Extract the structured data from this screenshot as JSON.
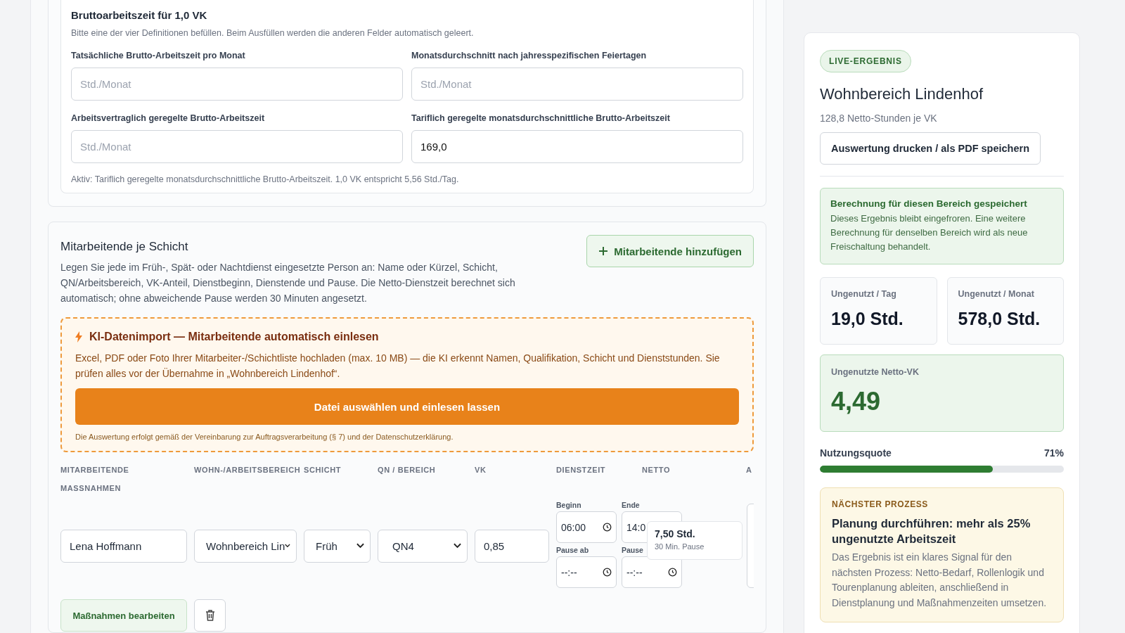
{
  "brutto": {
    "title": "Bruttoarbeitszeit für 1,0 VK",
    "hint": "Bitte eine der vier Definitionen befüllen. Beim Ausfüllen werden die anderen Felder automatisch geleert.",
    "fields": [
      {
        "label": "Tatsächliche Brutto-Arbeitszeit pro Monat",
        "placeholder": "Std./Monat"
      },
      {
        "label": "Monatsdurchschnitt nach jahresspezifischen Feiertagen",
        "placeholder": "Std./Monat"
      },
      {
        "label": "Arbeitsvertraglich geregelte Brutto-Arbeitszeit",
        "placeholder": "Std./Monat"
      },
      {
        "label": "Tariflich geregelte monatsdurchschnittliche Brutto-Arbeitszeit",
        "value": "169,0"
      }
    ],
    "active_note": "Aktiv: Tariflich geregelte monatsdurchschnittliche Brutto-Arbeitszeit. 1,0 VK entspricht 5,56 Std./Tag."
  },
  "staff": {
    "title": "Mitarbeitende je Schicht",
    "description": "Legen Sie jede im Früh-, Spät- oder Nachtdienst eingesetzte Person an: Name oder Kürzel, Schicht, QN/Arbeitsbereich, VK-Anteil, Dienstbeginn, Dienstende und Pause. Die Netto-Dienstzeit berechnet sich automatisch; ohne abweichende Pause werden 30 Minuten angesetzt.",
    "add_button": "Mitarbeitende hinzufügen",
    "import": {
      "title": "KI-Datenimport — Mitarbeitende automatisch einlesen",
      "text": "Excel, PDF oder Foto Ihrer Mitarbeiter-/Schichtliste hochladen (max. 10 MB) — die KI erkennt Namen, Qualifikation, Schicht und Dienststunden. Sie prüfen alles vor der Übernahme in „Wohnbereich Lindenhof“.",
      "button": "Datei auswählen und einlesen lassen",
      "note": "Die Auswertung erfolgt gemäß der Vereinbarung zur Auftragsverarbeitung (§ 7) und der Datenschutzerklärung."
    },
    "columns": [
      "MITARBEITENDE",
      "WOHN-/ARBEITSBEREICH",
      "SCHICHT",
      "QN / BEREICH",
      "VK",
      "DIENSTZEIT",
      "NETTO",
      "A",
      "MASSNAHMEN"
    ],
    "rows": [
      {
        "name": "Lena Hoffmann",
        "area": "Wohnbereich Lin",
        "shift": "Früh",
        "qualification": "QN4",
        "vk": "0,85",
        "start_label": "Beginn",
        "start": "06:00",
        "end_label": "Ende",
        "end": "14:0",
        "pause_from_label": "Pause ab",
        "pause_from": "--:--",
        "pause_to_label": "Pause",
        "pause_to": "--:--",
        "net_hours": "7,50 Std.",
        "net_pause": "30 Min. Pause",
        "actions_button": "Maßnahmen bearbeiten"
      }
    ]
  },
  "result": {
    "badge": "LIVE-ERGEBNIS",
    "title": "Wohnbereich Lindenhof",
    "subtitle": "128,8 Netto-Stunden je VK",
    "print_button": "Auswertung drucken / als PDF speichern",
    "saved": {
      "title": "Berechnung für diesen Bereich gespeichert",
      "text": "Dieses Ergebnis bleibt eingefroren. Eine weitere Berechnung für denselben Bereich wird als neue Freischaltung behandelt."
    },
    "stats": [
      {
        "label": "Ungenutzt / Tag",
        "value": "19,0 Std."
      },
      {
        "label": "Ungenutzt / Monat",
        "value": "578,0 Std."
      }
    ],
    "netto_vk": {
      "label": "Ungenutzte Netto-VK",
      "value": "4,49"
    },
    "usage": {
      "label": "Nutzungsquote",
      "reading": "71%",
      "level": 0.71
    },
    "next": {
      "kicker": "NÄCHSTER PROZESS",
      "title": "Planung durchführen: mehr als 25% ungenutzte Arbeitszeit",
      "text": "Das Ergebnis ist ein klares Signal für den nächsten Prozess: Netto-Bedarf, Rollenlogik und Tourenplanung ableiten, anschließend in Dienstplanung und Maßnahmenzeiten umsetzen."
    }
  }
}
